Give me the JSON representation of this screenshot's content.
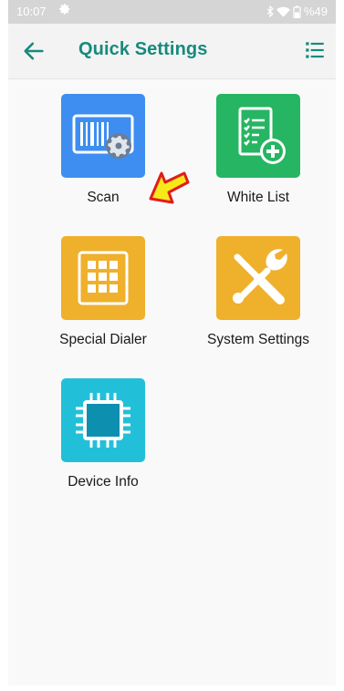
{
  "status_bar": {
    "time": "10:07",
    "battery": "%49",
    "icons": [
      "gear-icon",
      "bluetooth-icon",
      "wifi-icon",
      "battery-icon"
    ]
  },
  "app_bar": {
    "title": "Quick Settings",
    "back_icon": "arrow-left-icon",
    "menu_icon": "list-menu-icon",
    "accent_color": "#168a7c"
  },
  "tiles": [
    {
      "label": "Scan",
      "icon": "barcode-gear-icon",
      "color": "#3d8ef0"
    },
    {
      "label": "White List",
      "icon": "checklist-add-icon",
      "color": "#26b562"
    },
    {
      "label": "Special Dialer",
      "icon": "keypad-grid-icon",
      "color": "#efb02c"
    },
    {
      "label": "System Settings",
      "icon": "wrench-screwdriver-icon",
      "color": "#efb02c"
    },
    {
      "label": "Device Info",
      "icon": "chip-icon",
      "color": "#22c0d8"
    }
  ],
  "annotation": {
    "icon": "red-yellow-arrow-icon",
    "points_to": "Scan"
  }
}
